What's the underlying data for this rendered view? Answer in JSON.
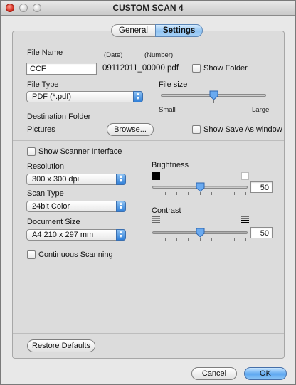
{
  "window": {
    "title": "CUSTOM SCAN 4"
  },
  "tabs": [
    {
      "label": "General"
    },
    {
      "label": "Settings"
    }
  ],
  "file_name": {
    "label": "File Name",
    "date_label": "(Date)",
    "number_label": "(Number)",
    "value": "CCF",
    "generated_name": "09112011_00000.pdf",
    "show_folder_label": "Show Folder"
  },
  "file_type": {
    "label": "File Type",
    "selected": "PDF (*.pdf)"
  },
  "file_size": {
    "label": "File size",
    "min_label": "Small",
    "max_label": "Large",
    "level": 0.5
  },
  "destination": {
    "label": "Destination Folder",
    "value": "Pictures",
    "browse_label": "Browse...",
    "show_save_as_label": "Show Save As window"
  },
  "scanner": {
    "show_interface_label": "Show Scanner Interface"
  },
  "resolution": {
    "label": "Resolution",
    "selected": "300 x 300 dpi"
  },
  "scan_type": {
    "label": "Scan Type",
    "selected": "24bit Color"
  },
  "document_size": {
    "label": "Document Size",
    "selected": "A4 210 x 297 mm"
  },
  "continuous_label": "Continuous Scanning",
  "brightness": {
    "label": "Brightness",
    "value": "50",
    "level": 0.5
  },
  "contrast": {
    "label": "Contrast",
    "value": "50",
    "level": 0.5
  },
  "footer": {
    "restore_label": "Restore Defaults",
    "cancel_label": "Cancel",
    "ok_label": "OK"
  },
  "colors": {
    "accent": "#5da7f0",
    "close": "#d2271b"
  }
}
